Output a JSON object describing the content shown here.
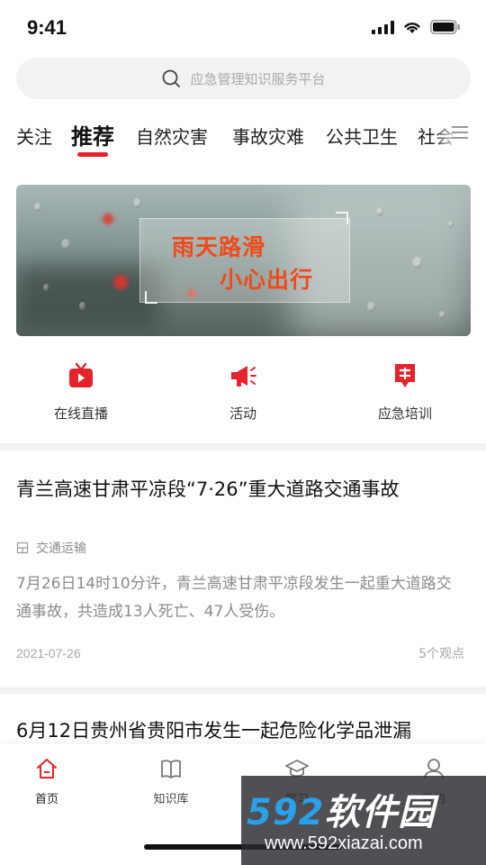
{
  "status": {
    "time": "9:41"
  },
  "search": {
    "placeholder": "应急管理知识服务平台"
  },
  "tabs": [
    "关注",
    "推荐",
    "自然灾害",
    "事故灾难",
    "公共卫生",
    "社会"
  ],
  "banner": {
    "line1": "雨天路滑",
    "line2": "小心出行"
  },
  "quick_entries": [
    {
      "label": "在线直播",
      "icon": "live-tv-icon"
    },
    {
      "label": "活动",
      "icon": "megaphone-icon"
    },
    {
      "label": "应急培训",
      "icon": "training-icon"
    }
  ],
  "articles": [
    {
      "title": "青兰高速甘肃平凉段“7·26”重大道路交通事故",
      "category": "交通运输",
      "summary": "7月26日14时10分许，青兰高速甘肃平凉段发生一起重大道路交通事故，共造成13人死亡、47人受伤。",
      "date": "2021-07-26",
      "views": "5个观点"
    },
    {
      "title": "6月12日贵州省贵阳市发生一起危险化学品泄漏"
    }
  ],
  "bottom_nav": [
    {
      "label": "首页",
      "icon": "home-icon"
    },
    {
      "label": "知识库",
      "icon": "book-icon"
    },
    {
      "label": "学习",
      "icon": "graduation-cap-icon"
    },
    {
      "label": "我的",
      "icon": "user-icon"
    }
  ],
  "colors": {
    "accent": "#e4232b",
    "banner_text": "#f04a1b"
  },
  "watermark": {
    "brand_num": "592",
    "brand_name": "软件园",
    "url": "www.592xiazai.com"
  }
}
